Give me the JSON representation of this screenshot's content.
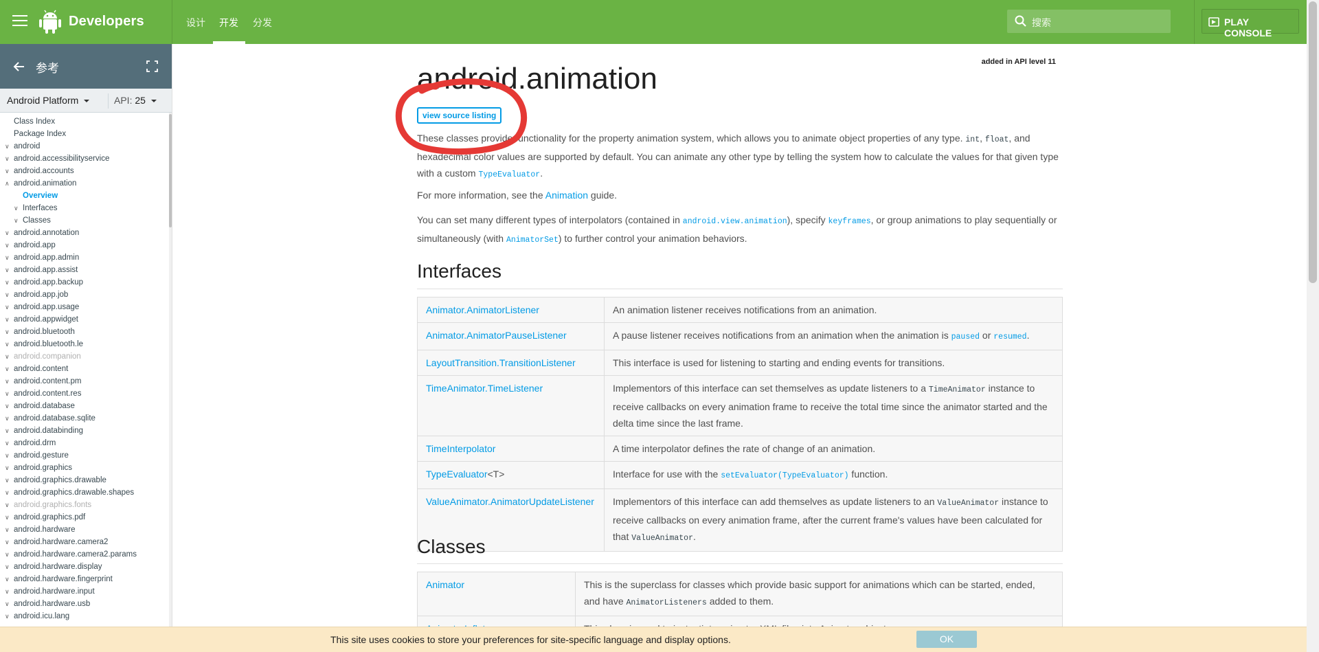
{
  "header": {
    "brand": "Developers",
    "tabs": [
      {
        "label": "设计"
      },
      {
        "label": "开发"
      },
      {
        "label": "分发"
      }
    ],
    "active_tab": "开发",
    "search_placeholder": "搜索",
    "play_console": "PLAY CONSOLE",
    "colors": {
      "topbar": "#6ab344",
      "link": "#039be5",
      "sidebar_head": "#546e7a"
    }
  },
  "sidebar": {
    "title": "参考",
    "platform": "Android Platform",
    "api_label": "API:",
    "api_value": "25",
    "items": [
      {
        "label": "Class Index",
        "arrow": ""
      },
      {
        "label": "Package Index",
        "arrow": ""
      },
      {
        "label": "android",
        "arrow": "∨"
      },
      {
        "label": "android.accessibilityservice",
        "arrow": "∨"
      },
      {
        "label": "android.accounts",
        "arrow": "∨"
      },
      {
        "label": "android.animation",
        "arrow": "∧"
      },
      {
        "label": "Overview",
        "arrow": "",
        "sub": true,
        "active": true
      },
      {
        "label": "Interfaces",
        "arrow": "∨",
        "sub": true
      },
      {
        "label": "Classes",
        "arrow": "∨",
        "sub": true
      },
      {
        "label": "android.annotation",
        "arrow": "∨"
      },
      {
        "label": "android.app",
        "arrow": "∨"
      },
      {
        "label": "android.app.admin",
        "arrow": "∨"
      },
      {
        "label": "android.app.assist",
        "arrow": "∨"
      },
      {
        "label": "android.app.backup",
        "arrow": "∨"
      },
      {
        "label": "android.app.job",
        "arrow": "∨"
      },
      {
        "label": "android.app.usage",
        "arrow": "∨"
      },
      {
        "label": "android.appwidget",
        "arrow": "∨"
      },
      {
        "label": "android.bluetooth",
        "arrow": "∨"
      },
      {
        "label": "android.bluetooth.le",
        "arrow": "∨"
      },
      {
        "label": "android.companion",
        "arrow": "∨",
        "disabled": true
      },
      {
        "label": "android.content",
        "arrow": "∨"
      },
      {
        "label": "android.content.pm",
        "arrow": "∨"
      },
      {
        "label": "android.content.res",
        "arrow": "∨"
      },
      {
        "label": "android.database",
        "arrow": "∨"
      },
      {
        "label": "android.database.sqlite",
        "arrow": "∨"
      },
      {
        "label": "android.databinding",
        "arrow": "∨"
      },
      {
        "label": "android.drm",
        "arrow": "∨"
      },
      {
        "label": "android.gesture",
        "arrow": "∨"
      },
      {
        "label": "android.graphics",
        "arrow": "∨"
      },
      {
        "label": "android.graphics.drawable",
        "arrow": "∨"
      },
      {
        "label": "android.graphics.drawable.shapes",
        "arrow": "∨"
      },
      {
        "label": "android.graphics.fonts",
        "arrow": "∨",
        "disabled": true
      },
      {
        "label": "android.graphics.pdf",
        "arrow": "∨"
      },
      {
        "label": "android.hardware",
        "arrow": "∨"
      },
      {
        "label": "android.hardware.camera2",
        "arrow": "∨"
      },
      {
        "label": "android.hardware.camera2.params",
        "arrow": "∨"
      },
      {
        "label": "android.hardware.display",
        "arrow": "∨"
      },
      {
        "label": "android.hardware.fingerprint",
        "arrow": "∨"
      },
      {
        "label": "android.hardware.input",
        "arrow": "∨"
      },
      {
        "label": "android.hardware.usb",
        "arrow": "∨"
      },
      {
        "label": "android.icu.lang",
        "arrow": "∨"
      }
    ]
  },
  "main": {
    "api_level": "added in API level 11",
    "title": "android.animation",
    "view_source": "view source listing",
    "intro": {
      "t1": "These classes provide functionality for the property animation system, which allows you to animate object properties of any type. ",
      "c1": "int",
      "t2": ", ",
      "c2": "float",
      "t3": ", and hexadecimal color values are supported by default. You can animate any other type by telling the system how to calculate the values for that given type with a custom ",
      "c3": "TypeEvaluator",
      "t4": "."
    },
    "more_info": {
      "t1": "For more information, see the ",
      "link": "Animation",
      "t2": " guide."
    },
    "interp": {
      "t1": "You can set many different types of interpolators (contained in ",
      "c1": "android.view.animation",
      "t2": "), specify ",
      "c2": "keyframes",
      "t3": ", or group animations to play sequentially or simultaneously (with ",
      "c3": "AnimatorSet",
      "t4": ") to further control your animation behaviors."
    },
    "interfaces_heading": "Interfaces",
    "interfaces": [
      {
        "name": "Animator.AnimatorListener",
        "desc": "An animation listener receives notifications from an animation."
      },
      {
        "name": "Animator.AnimatorPauseListener",
        "d1": "A pause listener receives notifications from an animation when the animation is ",
        "c1": "paused",
        "d2": " or ",
        "c2": "resumed",
        "d3": "."
      },
      {
        "name": "LayoutTransition.TransitionListener",
        "desc": "This interface is used for listening to starting and ending events for transitions."
      },
      {
        "name": "TimeAnimator.TimeListener",
        "d1": "Implementors of this interface can set themselves as update listeners to a ",
        "c1": "TimeAnimator",
        "d2": " instance to receive callbacks on every animation frame to receive the total time since the animator started and the delta time since the last frame."
      },
      {
        "name": "TimeInterpolator",
        "desc": "A time interpolator defines the rate of change of an animation."
      },
      {
        "name": "TypeEvaluator",
        "suffix": "<T>",
        "d1": "Interface for use with the ",
        "c1": "setEvaluator(TypeEvaluator)",
        "d2": " function."
      },
      {
        "name": "ValueAnimator.AnimatorUpdateListener",
        "d1": "Implementors of this interface can add themselves as update listeners to an ",
        "c1": "ValueAnimator",
        "d2": " instance to receive callbacks on every animation frame, after the current frame's values have been calculated for that ",
        "c2": "ValueAnimator",
        "d3": "."
      }
    ],
    "classes_heading": "Classes",
    "classes": [
      {
        "name": "Animator",
        "d1": "This is the superclass for classes which provide basic support for animations which can be started, ended, and have ",
        "c1": "AnimatorListeners",
        "d2": " added to them."
      },
      {
        "name": "AnimatorInflater",
        "desc": "This class is used to instantiate animator XML files into Animator objects."
      }
    ]
  },
  "cookie": {
    "message": "This site uses cookies to store your preferences for site-specific language and display options.",
    "ok": "OK"
  }
}
